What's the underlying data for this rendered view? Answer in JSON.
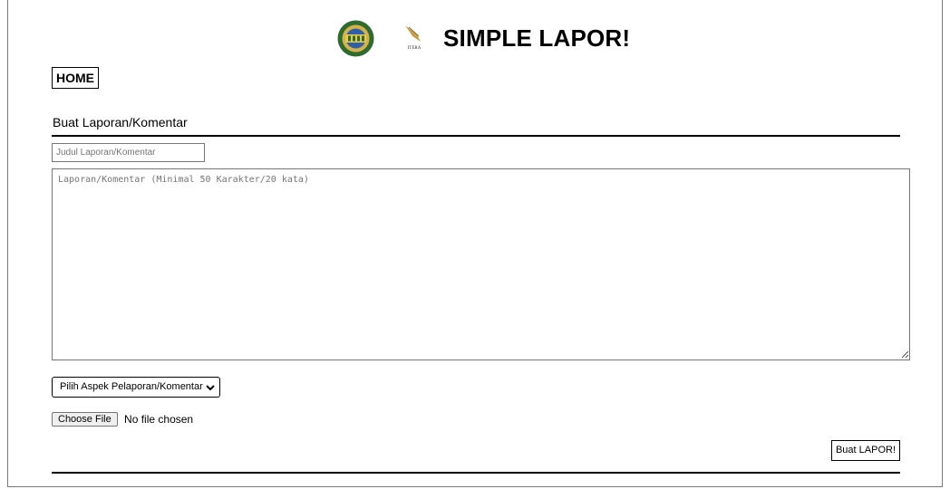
{
  "header": {
    "logo_left_icon": "institution-emblem-icon",
    "logo_right_icon": "itera-logo-icon",
    "logo_right_caption": "ITERA",
    "title": "SIMPLE LAPOR!"
  },
  "nav": {
    "home_label": "HOME"
  },
  "form": {
    "section_title": "Buat Laporan/Komentar",
    "title_placeholder": "Judul Laporan/Komentar",
    "title_value": "",
    "body_placeholder": "Laporan/Komentar (Minimal 50 Karakter/20 kata)",
    "body_value": "",
    "aspect_selected": "Pilih Aspek Pelaporan/Komentar",
    "file_button_label": "Choose File",
    "file_status": "No file chosen",
    "submit_label": "Buat LAPOR!"
  },
  "colors": {
    "logo_green": "#2e6b2f",
    "logo_gold": "#d4b14a",
    "text": "#000000",
    "border": "#767676"
  }
}
